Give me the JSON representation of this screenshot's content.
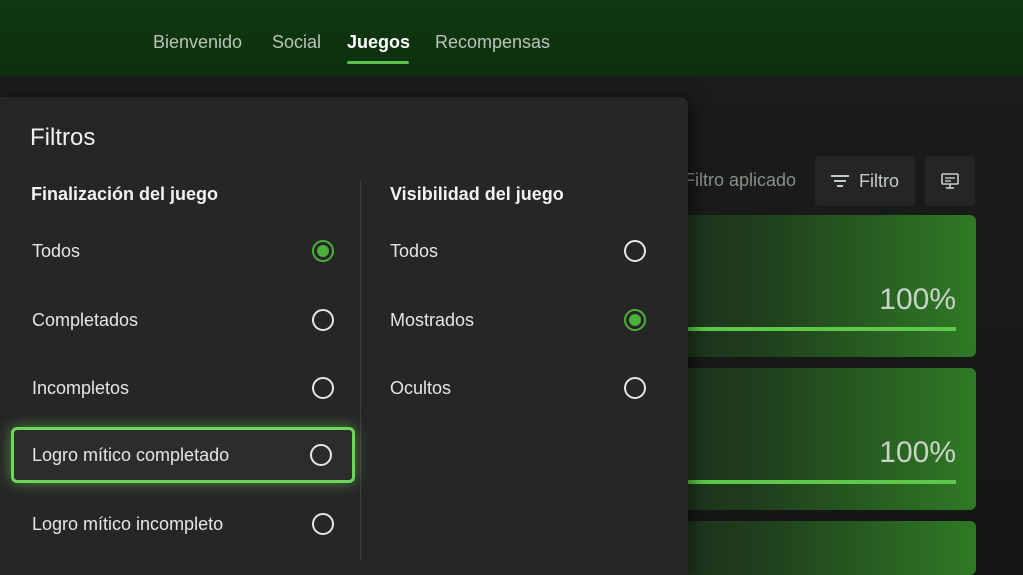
{
  "nav": {
    "tabs": [
      {
        "label": "Bienvenido",
        "active": false
      },
      {
        "label": "Social",
        "active": false
      },
      {
        "label": "Juegos",
        "active": true
      },
      {
        "label": "Recompensas",
        "active": false
      }
    ]
  },
  "toolbar": {
    "filter_applied": "Filtro aplicado",
    "filter_button": "Filtro",
    "filter_icon": "filter-lines-icon",
    "view_icon": "display-options-icon"
  },
  "cards": [
    {
      "percent": "100%"
    },
    {
      "percent": "100%"
    }
  ],
  "panel": {
    "title": "Filtros",
    "completion": {
      "title": "Finalización del juego",
      "options": [
        {
          "label": "Todos",
          "selected": true
        },
        {
          "label": "Completados",
          "selected": false
        },
        {
          "label": "Incompletos",
          "selected": false
        },
        {
          "label": "Logro mítico completado",
          "selected": false,
          "focused": true
        },
        {
          "label": "Logro mítico incompleto",
          "selected": false
        }
      ]
    },
    "visibility": {
      "title": "Visibilidad del juego",
      "options": [
        {
          "label": "Todos",
          "selected": false
        },
        {
          "label": "Mostrados",
          "selected": true
        },
        {
          "label": "Ocultos",
          "selected": false
        }
      ]
    }
  },
  "colors": {
    "accent": "#4caf3a",
    "focus": "#6fd65a",
    "nav_bg": "#0f3a10",
    "panel_bg": "#262626"
  }
}
